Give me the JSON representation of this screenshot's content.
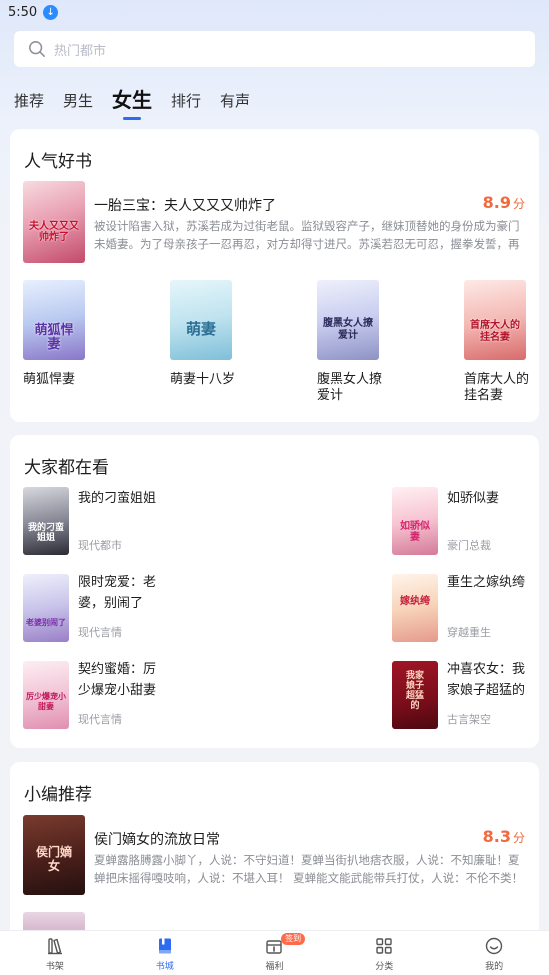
{
  "status": {
    "time": "5:50"
  },
  "search": {
    "placeholder": "热门都市"
  },
  "tabs": [
    {
      "label": "推荐"
    },
    {
      "label": "男生"
    },
    {
      "label": "女生",
      "active": true
    },
    {
      "label": "排行"
    },
    {
      "label": "有声"
    }
  ],
  "popular": {
    "title": "人气好书",
    "featured": {
      "title": "一胎三宝：夫人又又又帅炸了",
      "score": "8.9",
      "score_unit": "分",
      "desc": "被设计陷害入狱，苏溪若成为过街老鼠。监狱毁容产子，继妹顶替她的身份成为豪门未婚妻。为了母亲孩子一忍再忍，对方却得寸进尺。苏溪若忍无可忍，握拳发誓，再忍她就...",
      "cover_text": "夫人又又又帅炸了"
    },
    "grid": [
      {
        "name": "萌狐悍妻",
        "cover_text": "萌狐悍妻"
      },
      {
        "name": "萌妻十八岁",
        "cover_text": "萌妻"
      },
      {
        "name": "腹黑女人撩爱计",
        "cover_text": "腹黑女人撩爱计"
      },
      {
        "name": "首席大人的挂名妻",
        "cover_text": "首席大人的挂名妻"
      }
    ]
  },
  "watching": {
    "title": "大家都在看",
    "items": [
      {
        "title": "我的刁蛮姐姐",
        "category": "现代都市",
        "cover_text": "我的刁蛮姐姐"
      },
      {
        "title": "如骄似妻",
        "category": "豪门总裁",
        "cover_text": "如骄似妻"
      },
      {
        "title": "限时宠爱：老婆，别闹了",
        "category": "现代言情",
        "cover_text": "老婆别闹了"
      },
      {
        "title": "重生之嫁纨绔",
        "category": "穿越重生",
        "cover_text": "嫁纨绔"
      },
      {
        "title": "契约蜜婚：厉少爆宠小甜妻",
        "category": "现代言情",
        "cover_text": "厉少爆宠小甜妻"
      },
      {
        "title": "冲喜农女：我家娘子超猛的",
        "category": "古言架空",
        "cover_text": "我家娘子超猛的"
      }
    ]
  },
  "editor": {
    "title": "小编推荐",
    "featured": {
      "title": "侯门嫡女的流放日常",
      "score": "8.3",
      "score_unit": "分",
      "desc": "夏蝉露胳膊露小脚丫，人说：不守妇道！夏蝉当街扒地痞衣服，人说：不知廉耻！夏蝉把床摇得嘎吱响，人说：不堪入耳！ 夏蝉能文能武能带兵打仗，人说：不伦不类！ 某...",
      "cover_text": "侯门嫡女"
    }
  },
  "nav": [
    {
      "label": "书架",
      "icon": "bookshelf-icon"
    },
    {
      "label": "书城",
      "icon": "bookstore-icon",
      "active": true
    },
    {
      "label": "福利",
      "icon": "gift-icon",
      "badge": "签到"
    },
    {
      "label": "分类",
      "icon": "category-icon"
    },
    {
      "label": "我的",
      "icon": "profile-icon"
    }
  ],
  "colors": {
    "accent": "#2d6bf0",
    "score": "#ef6a3d",
    "badge": "#ff6b4a"
  }
}
